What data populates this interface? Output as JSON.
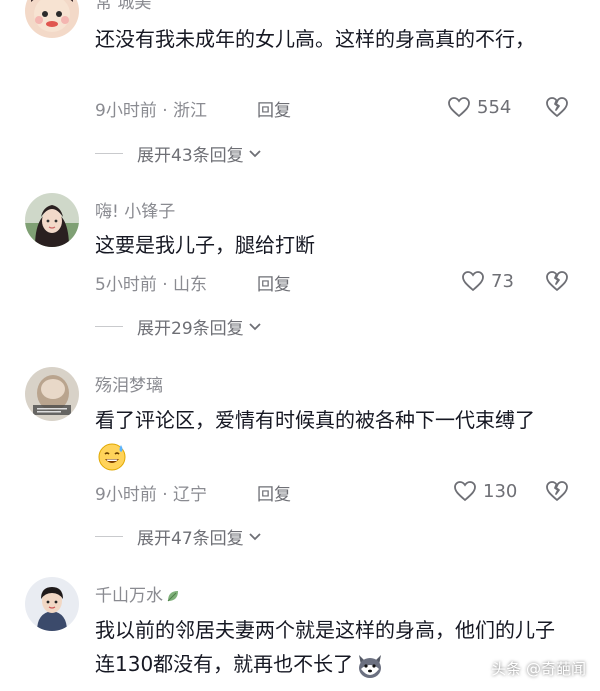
{
  "comments": [
    {
      "username": "常 城美",
      "text": "还没有我未成年的女儿高。这样的身高真的不行，",
      "time_location": "9小时前 · 浙江",
      "reply_label": "回复",
      "likes": "554",
      "expand_label": "展开43条回复"
    },
    {
      "username": "嗨! 小锋子",
      "text": "这要是我儿子，腿给打断",
      "time_location": "5小时前 · 山东",
      "reply_label": "回复",
      "likes": "73",
      "expand_label": "展开29条回复"
    },
    {
      "username": "殇泪梦璃",
      "text": "看了评论区，爱情有时候真的被各种下一代束缚了",
      "time_location": "9小时前 · 辽宁",
      "reply_label": "回复",
      "likes": "130",
      "expand_label": "展开47条回复"
    },
    {
      "username": "千山万水",
      "text": "我以前的邻居夫妻两个就是这样的身高，他们的儿子连130都没有，就再也不长了"
    }
  ],
  "watermark": "头条 @奇葩闻",
  "icons": {
    "like": "heart-outline-icon",
    "dislike": "broken-heart-icon",
    "expand": "chevron-down-icon",
    "emoji_sweat": "sweat-smile-emoji",
    "emoji_husky": "husky-dog-emoji",
    "name_badge": "leaf-badge-icon"
  }
}
